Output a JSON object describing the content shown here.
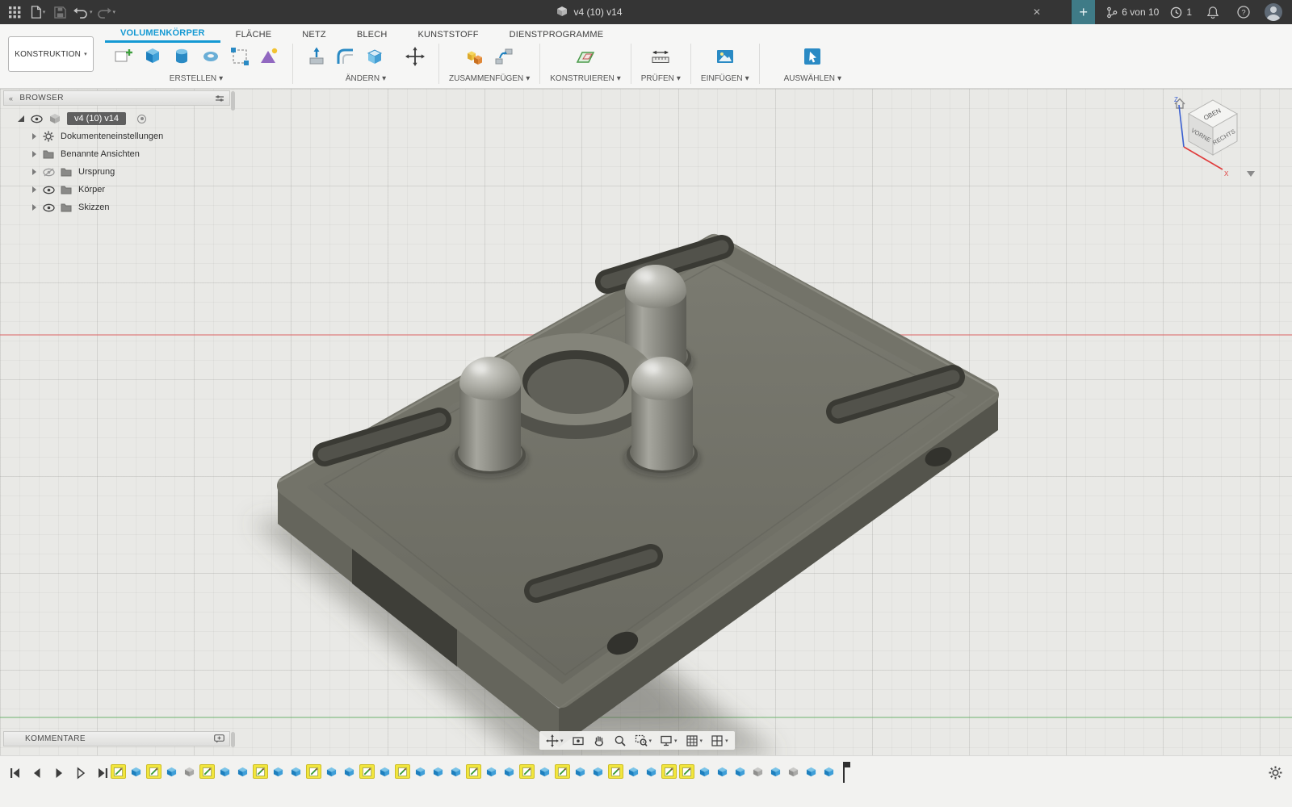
{
  "glyphs": {
    "caret": "▾",
    "close": "✕",
    "collapse": "«",
    "plus": "+"
  },
  "titlebar": {
    "doc_title": "v4 (10) v14",
    "version_info": "6 von 10",
    "notification_count": "1"
  },
  "ribbon_tabs": [
    {
      "label": "VOLUMENKÖRPER",
      "active": true
    },
    {
      "label": "FLÄCHE",
      "active": false
    },
    {
      "label": "NETZ",
      "active": false
    },
    {
      "label": "BLECH",
      "active": false
    },
    {
      "label": "KUNSTSTOFF",
      "active": false
    },
    {
      "label": "DIENSTPROGRAMME",
      "active": false
    }
  ],
  "toolbar": {
    "workspace_selector": "KONSTRUKTION",
    "groups": [
      {
        "label": "ERSTELLEN"
      },
      {
        "label": "ÄNDERN"
      },
      {
        "label": "ZUSAMMENFÜGEN"
      },
      {
        "label": "KONSTRUIEREN"
      },
      {
        "label": "PRÜFEN"
      },
      {
        "label": "EINFÜGEN"
      },
      {
        "label": "AUSWÄHLEN"
      }
    ]
  },
  "browser": {
    "header": "BROWSER",
    "root_label": "v4 (10) v14",
    "items": [
      {
        "label": "Dokumenteneinstellungen"
      },
      {
        "label": "Benannte Ansichten"
      },
      {
        "label": "Ursprung"
      },
      {
        "label": "Körper"
      },
      {
        "label": "Skizzen"
      }
    ]
  },
  "viewcube": {
    "top": "OBEN",
    "front": "VORNE",
    "right": "RECHTS",
    "axis_x": "X",
    "axis_z": "Z"
  },
  "comments": {
    "header": "KOMMENTARE"
  },
  "timeline": {
    "items": [
      "sketch",
      "feature",
      "sketch",
      "feature",
      "feature-gray",
      "sketch",
      "feature",
      "feature",
      "sketch",
      "feature",
      "feature",
      "sketch",
      "feature",
      "feature",
      "sketch",
      "feature",
      "sketch",
      "feature",
      "feature",
      "feature",
      "sketch",
      "feature",
      "feature",
      "sketch",
      "feature",
      "sketch",
      "feature",
      "feature",
      "sketch",
      "feature",
      "feature",
      "sketch",
      "sketch",
      "feature",
      "feature",
      "feature",
      "feature-gray",
      "feature",
      "feature-gray",
      "feature",
      "feature"
    ]
  },
  "colors": {
    "accent": "#1499d3",
    "timeline_highlight": "#f2e63d",
    "axis_red": "#dc6464",
    "axis_green": "#6eb46e"
  }
}
